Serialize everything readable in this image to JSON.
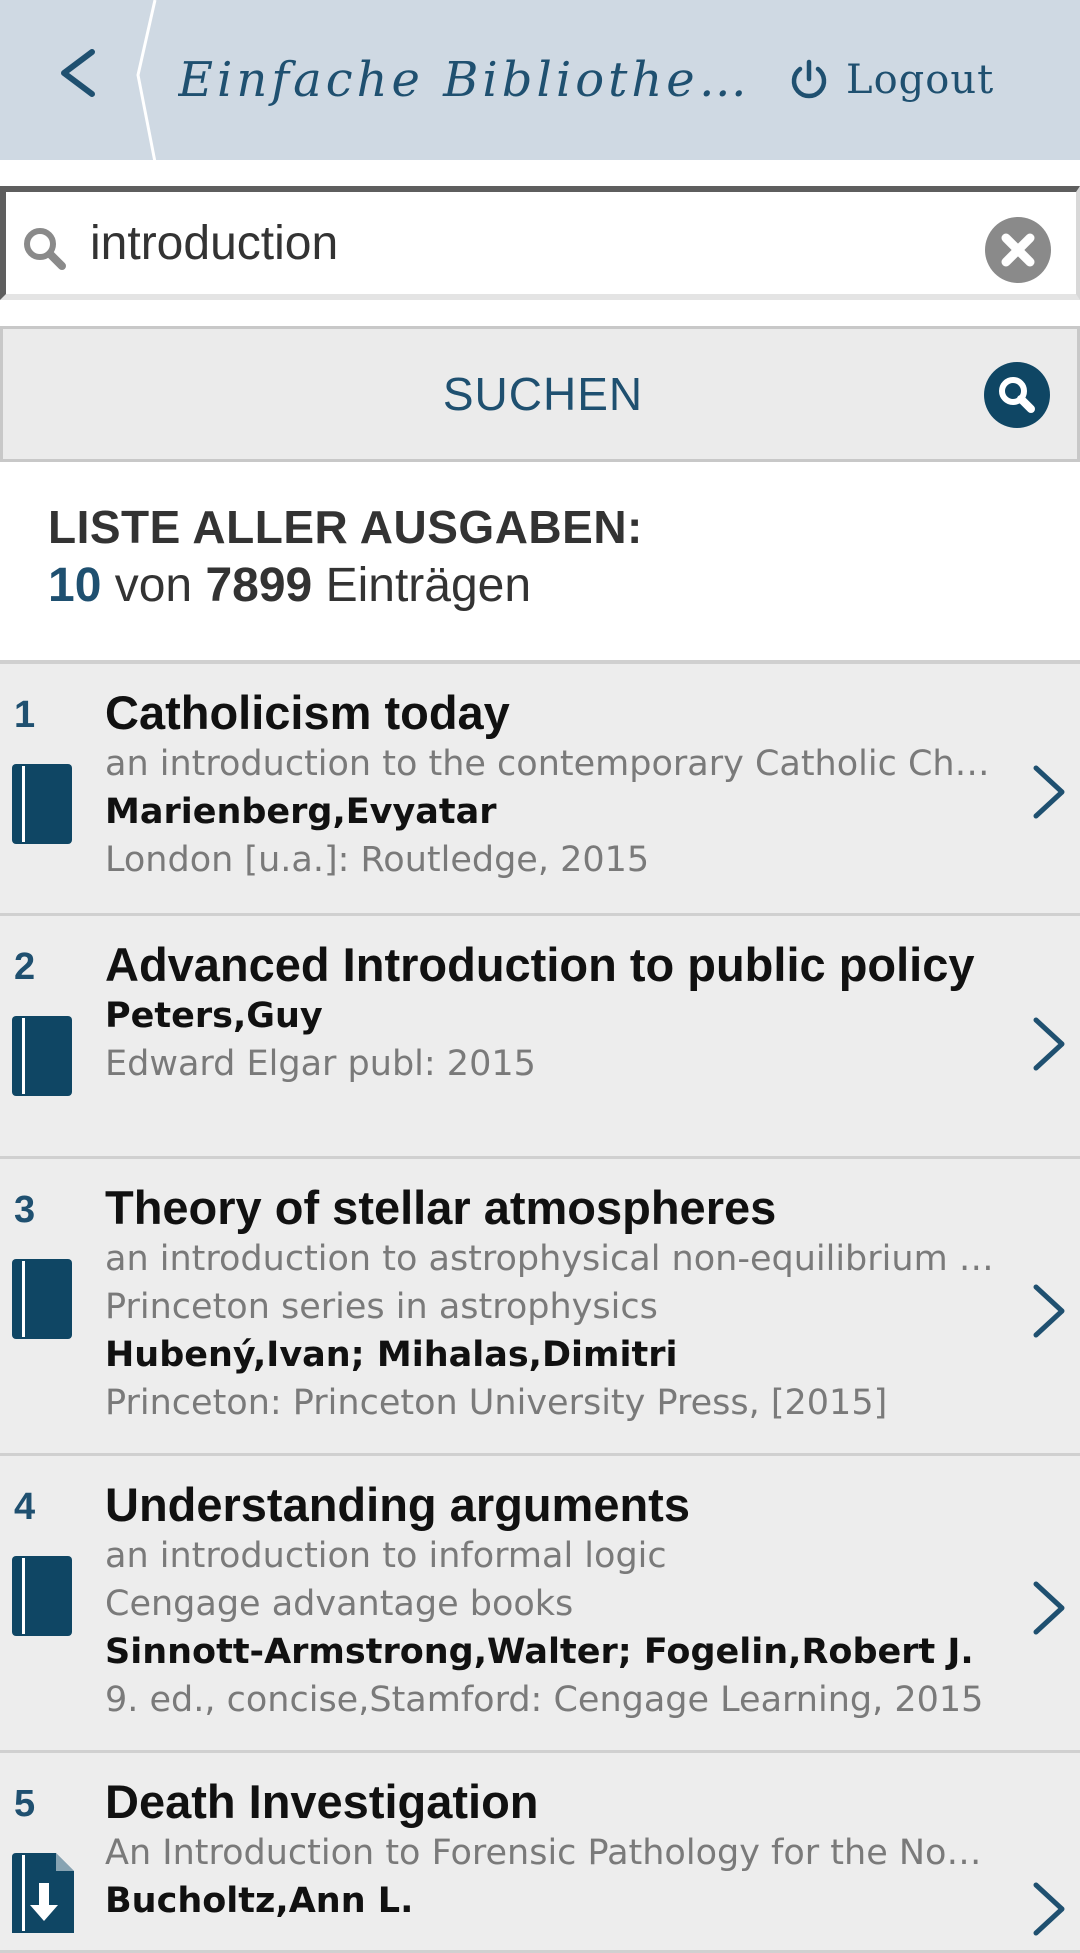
{
  "header": {
    "title": "Einfache Bibliotheks...",
    "logout_label": "Logout"
  },
  "search": {
    "value": "introduction",
    "button_label": "SUCHEN"
  },
  "results_header": {
    "title": "LISTE ALLER AUSGABEN:",
    "shown": "10",
    "von": "von",
    "total": "7899",
    "suffix": "Einträgen"
  },
  "results": [
    {
      "num": "1",
      "title": "Catholicism today",
      "lines": [
        "an introduction to the contemporary Catholic Church"
      ],
      "author": "Marienberg,Evyatar",
      "publication": "London [u.a.]: Routledge, 2015",
      "icon": "book-icon"
    },
    {
      "num": "2",
      "title": "Advanced Introduction to public policy",
      "lines": [],
      "author": "Peters,Guy",
      "publication": "Edward Elgar publ: 2015",
      "icon": "book-icon"
    },
    {
      "num": "3",
      "title": "Theory of stellar atmospheres",
      "lines": [
        "an introduction to astrophysical non-equilibrium qu...",
        "Princeton series in astrophysics"
      ],
      "author": "Hubený,Ivan; Mihalas,Dimitri",
      "publication": "Princeton: Princeton University Press, [2015]",
      "icon": "book-icon"
    },
    {
      "num": "4",
      "title": "Understanding arguments",
      "lines": [
        "an introduction to informal logic",
        "Cengage advantage books"
      ],
      "author": "Sinnott-Armstrong,Walter; Fogelin,Robert J.",
      "publication": "9. ed., concise,Stamford: Cengage Learning, 2015",
      "icon": "book-icon"
    },
    {
      "num": "5",
      "title": "Death Investigation",
      "lines": [
        "An Introduction to Forensic Pathology for the Nons..."
      ],
      "author": "Bucholtz,Ann L.",
      "publication": "",
      "icon": "ebook-download-icon"
    }
  ],
  "colors": {
    "header_bg": "#cfd9e3",
    "accent": "#1f5070",
    "list_bg": "#ededed"
  }
}
